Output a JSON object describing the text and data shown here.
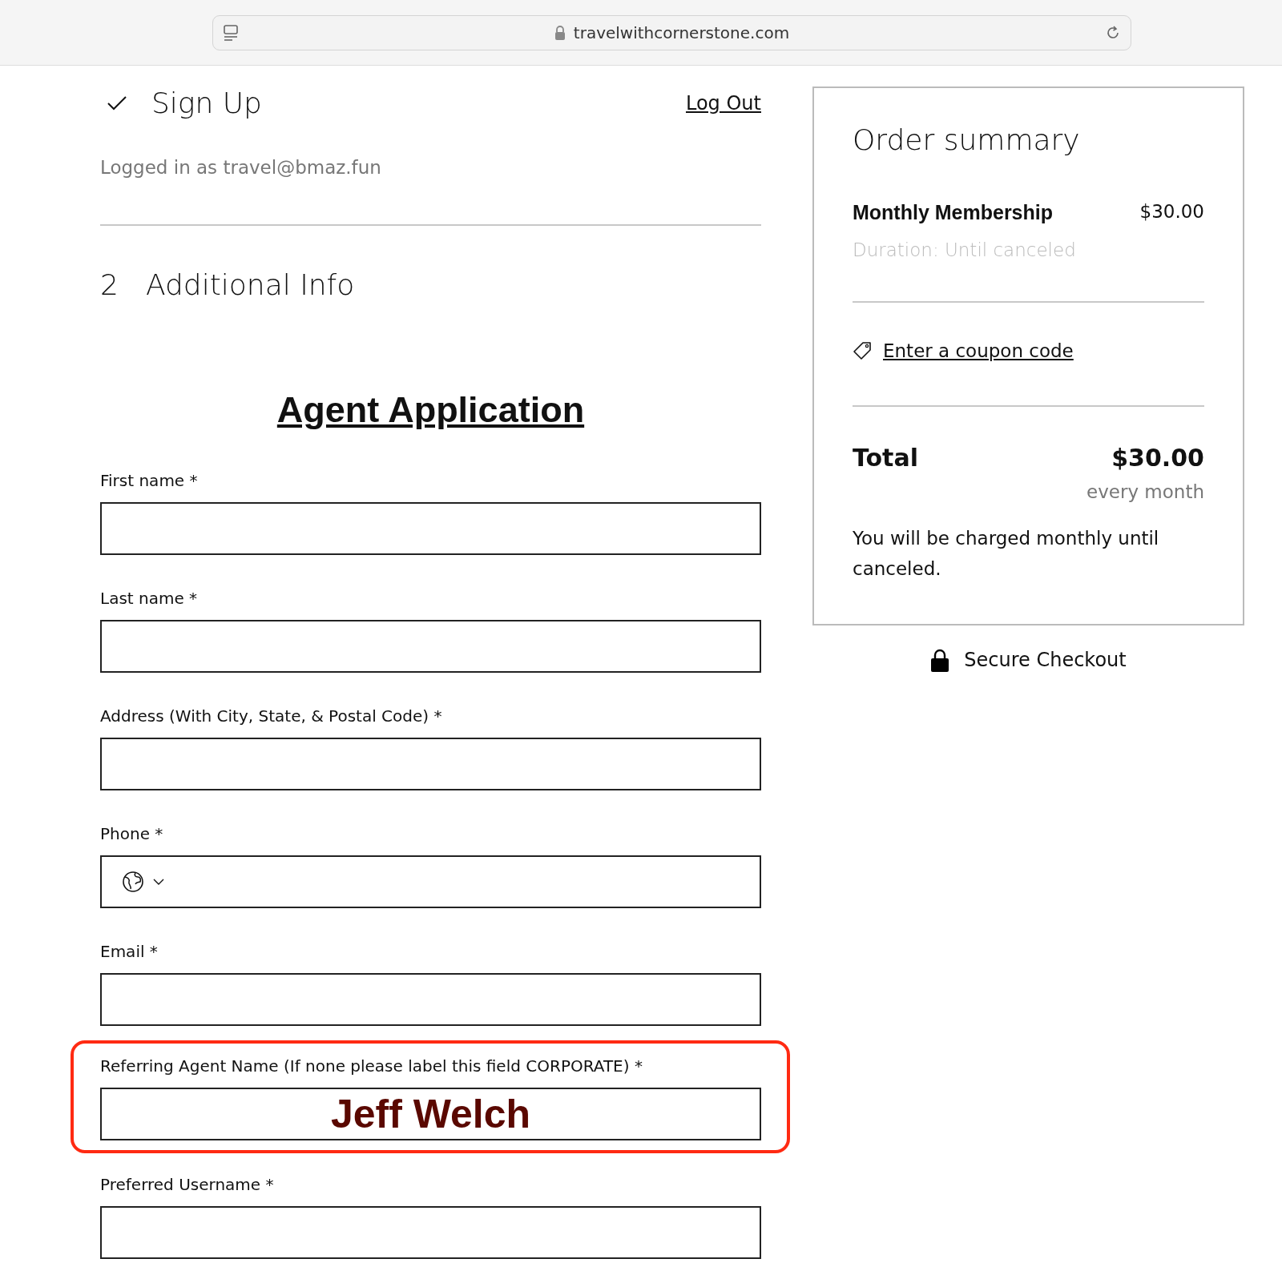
{
  "browser": {
    "url": "travelwithcornerstone.com"
  },
  "signup": {
    "step_done": true,
    "title": "Sign Up",
    "logout": "Log Out",
    "logged_in": "Logged in as travel@bmaz.fun"
  },
  "step": {
    "number": "2",
    "title": "Additional Info"
  },
  "form": {
    "heading": "Agent Application",
    "fields": [
      {
        "kind": "text",
        "label": "First name *",
        "highlighted": false
      },
      {
        "kind": "text",
        "label": "Last name *",
        "highlighted": false
      },
      {
        "kind": "text",
        "label": "Address (With City, State, & Postal Code) *",
        "highlighted": false
      },
      {
        "kind": "phone",
        "label": "Phone *",
        "highlighted": false
      },
      {
        "kind": "text",
        "label": "Email *",
        "highlighted": false
      },
      {
        "kind": "text",
        "label": "Referring Agent Name (If none please label this field CORPORATE) *",
        "value": "Jeff Welch",
        "highlighted": true
      },
      {
        "kind": "text",
        "label": "Preferred Username *",
        "highlighted": false
      }
    ]
  },
  "order_summary": {
    "title": "Order summary",
    "item": "Monthly Membership",
    "price": "$30.00",
    "duration": "Duration: Until canceled",
    "coupon": "Enter a coupon code",
    "total_label": "Total",
    "total": "$30.00",
    "period": "every month",
    "note": "You will be charged monthly until canceled."
  },
  "secure": "Secure Checkout"
}
